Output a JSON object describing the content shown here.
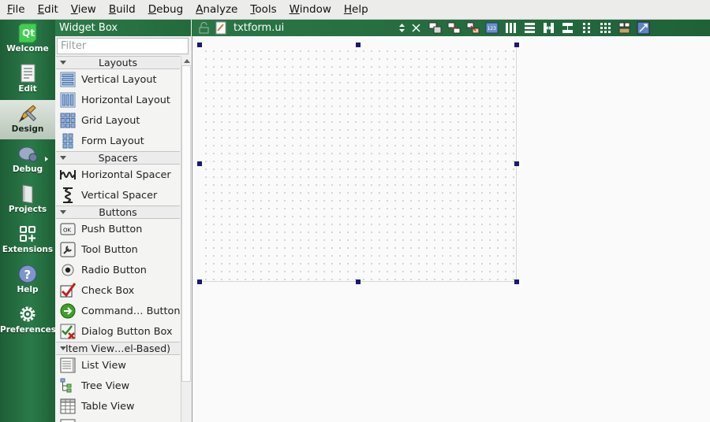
{
  "menu": [
    "File",
    "Edit",
    "View",
    "Build",
    "Debug",
    "Analyze",
    "Tools",
    "Window",
    "Help"
  ],
  "modes": [
    {
      "label": "Welcome",
      "icon": "qt-logo-icon",
      "active": false
    },
    {
      "label": "Edit",
      "icon": "document-edit-icon",
      "active": false
    },
    {
      "label": "Design",
      "icon": "pencil-ruler-icon",
      "active": true
    },
    {
      "label": "Debug",
      "icon": "bug-icon",
      "active": false
    },
    {
      "label": "Projects",
      "icon": "folder-icon",
      "active": false
    },
    {
      "label": "Extensions",
      "icon": "extensions-icon",
      "active": false
    },
    {
      "label": "Help",
      "icon": "help-icon",
      "active": false
    },
    {
      "label": "Preferences",
      "icon": "gear-icon",
      "active": false
    }
  ],
  "widget_box": {
    "title": "Widget Box",
    "filter_placeholder": "Filter",
    "categories": {
      "layouts": "Layouts",
      "spacers": "Spacers",
      "buttons": "Buttons",
      "item_views": "Item View…el-Based)"
    },
    "items": {
      "vertical_layout": "Vertical Layout",
      "horizontal_layout": "Horizontal Layout",
      "grid_layout": "Grid Layout",
      "form_layout": "Form Layout",
      "horizontal_spacer": "Horizontal Spacer",
      "vertical_spacer": "Vertical Spacer",
      "push_button": "Push Button",
      "tool_button": "Tool Button",
      "radio_button": "Radio Button",
      "check_box": "Check Box",
      "command_link_button": "Command… Button",
      "dialog_button_box": "Dialog Button Box",
      "list_view": "List View",
      "tree_view": "Tree View",
      "table_view": "Table View"
    }
  },
  "editor": {
    "file_name": "txtform.ui",
    "toolbar_icons": [
      "edit-widgets-icon",
      "edit-signals-slots-icon",
      "edit-buddies-icon",
      "edit-tab-order-icon",
      "layout-horizontal-icon",
      "layout-vertical-icon",
      "layout-horizontal-splitter-icon",
      "layout-vertical-splitter-icon",
      "layout-form-icon",
      "layout-grid-icon",
      "break-layout-icon",
      "adjust-size-icon"
    ]
  },
  "colors": {
    "mode_bar": "#2a7a48",
    "selection_handle": "#1a1a6e"
  }
}
